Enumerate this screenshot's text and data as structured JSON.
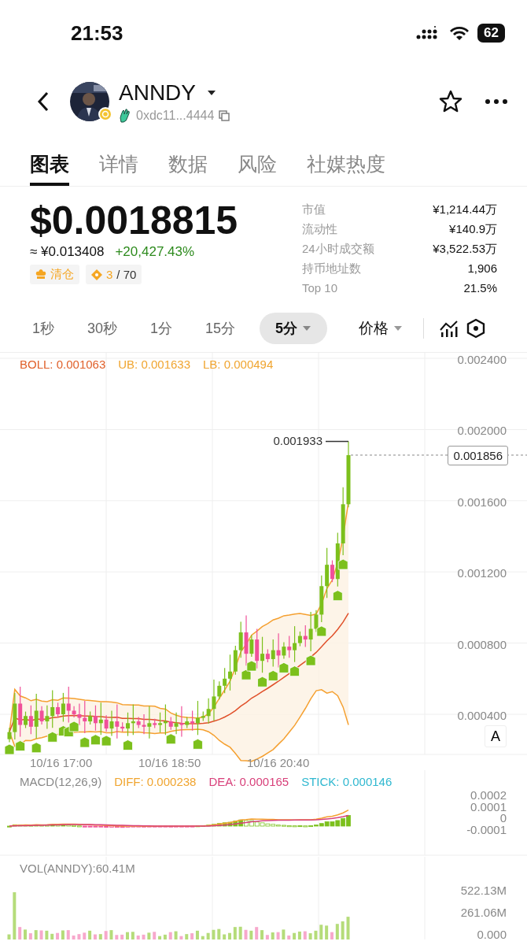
{
  "status_bar": {
    "time": "21:53",
    "battery": "62"
  },
  "token": {
    "name": "ANNDY",
    "address": "0xdc11...4444"
  },
  "tabs": [
    {
      "label": "图表",
      "selected": true
    },
    {
      "label": "详情",
      "selected": false
    },
    {
      "label": "数据",
      "selected": false
    },
    {
      "label": "风险",
      "selected": false
    },
    {
      "label": "社媒热度",
      "selected": false
    }
  ],
  "price": {
    "value": "$0.0018815",
    "cny": "≈ ¥0.013408",
    "change": "+20,427.43%",
    "tags": [
      {
        "kind": "clear",
        "label": "清仓"
      },
      {
        "kind": "rank",
        "rank": "3",
        "total": "/ 70"
      }
    ]
  },
  "stats": [
    {
      "label": "市值",
      "value": "¥1,214.44万"
    },
    {
      "label": "流动性",
      "value": "¥140.9万"
    },
    {
      "label": "24小时成交额",
      "value": "¥3,522.53万"
    },
    {
      "label": "持币地址数",
      "value": "1,906"
    },
    {
      "label": "Top 10",
      "value": "21.5%"
    }
  ],
  "intervals": [
    {
      "label": "1秒",
      "selected": false
    },
    {
      "label": "30秒",
      "selected": false
    },
    {
      "label": "1分",
      "selected": false
    },
    {
      "label": "15分",
      "selected": false
    },
    {
      "label": "5分",
      "selected": true
    }
  ],
  "indicator_select": "价格",
  "chart": {
    "legend": [
      {
        "text": "BOLL: 0.001063",
        "color": "#e0602a"
      },
      {
        "text": "UB: 0.001633",
        "color": "#f0a530"
      },
      {
        "text": "LB: 0.000494",
        "color": "#f0a530"
      }
    ],
    "y_labels": [
      "0.002400",
      "0.002000",
      "0.001600",
      "0.001200",
      "0.000800",
      "0.000400"
    ],
    "x_labels": [
      "10/16 17:00",
      "10/16 18:50",
      "10/16 20:40"
    ],
    "high_label": "0.001933",
    "current_label": "0.001856",
    "auto_button": "A"
  },
  "macd": {
    "title": "MACD(12,26,9)",
    "legend": [
      {
        "text": "DIFF: 0.000238",
        "color": "#f0a530"
      },
      {
        "text": "DEA: 0.000165",
        "color": "#d8407a"
      },
      {
        "text": "STICK: 0.000146",
        "color": "#30b8d0"
      }
    ],
    "y_labels": [
      "0.0002",
      "0.0001",
      "0",
      "-0.0001"
    ]
  },
  "volume": {
    "title": "VOL(ANNDY):60.41M",
    "y_labels": [
      "522.13M",
      "261.06M",
      "0.000"
    ]
  }
}
